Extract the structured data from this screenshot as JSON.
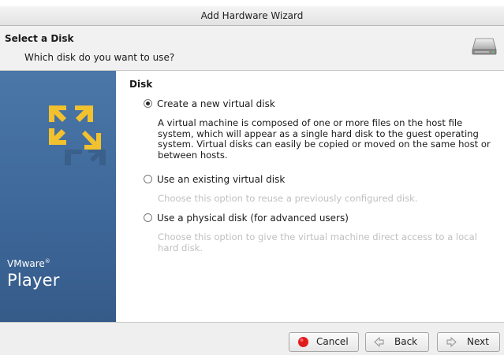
{
  "window": {
    "title": "Add Hardware Wizard"
  },
  "header": {
    "title": "Select a Disk",
    "subtitle": "Which disk do you want to use?",
    "icon": "hard-disk-icon"
  },
  "sidebar": {
    "brand_vmware": "VMware",
    "brand_reg": "®",
    "brand_product": "Player"
  },
  "section": {
    "title": "Disk"
  },
  "options": [
    {
      "label": "Create a new virtual disk",
      "selected": true,
      "description": "A virtual machine is composed of one or more files on the host file system, which will appear as a single hard disk to the guest operating system. Virtual disks can easily be copied or moved on the same host or between hosts."
    },
    {
      "label": "Use an existing virtual disk",
      "selected": false,
      "description": "Choose this option to reuse a previously configured disk."
    },
    {
      "label": "Use a physical disk (for advanced users)",
      "selected": false,
      "description": "Choose this option to give the virtual machine direct access to a local hard disk."
    }
  ],
  "buttons": {
    "cancel": {
      "label": "Cancel",
      "icon": "cancel-red-dot-icon"
    },
    "back": {
      "label": "Back",
      "icon": "back-arrow-icon"
    },
    "next": {
      "label": "Next",
      "icon": "next-arrow-icon"
    }
  },
  "colors": {
    "sidebar": "#3e689a",
    "logo_yellow": "#f2c12e",
    "cancel_red": "#e01b1b"
  }
}
